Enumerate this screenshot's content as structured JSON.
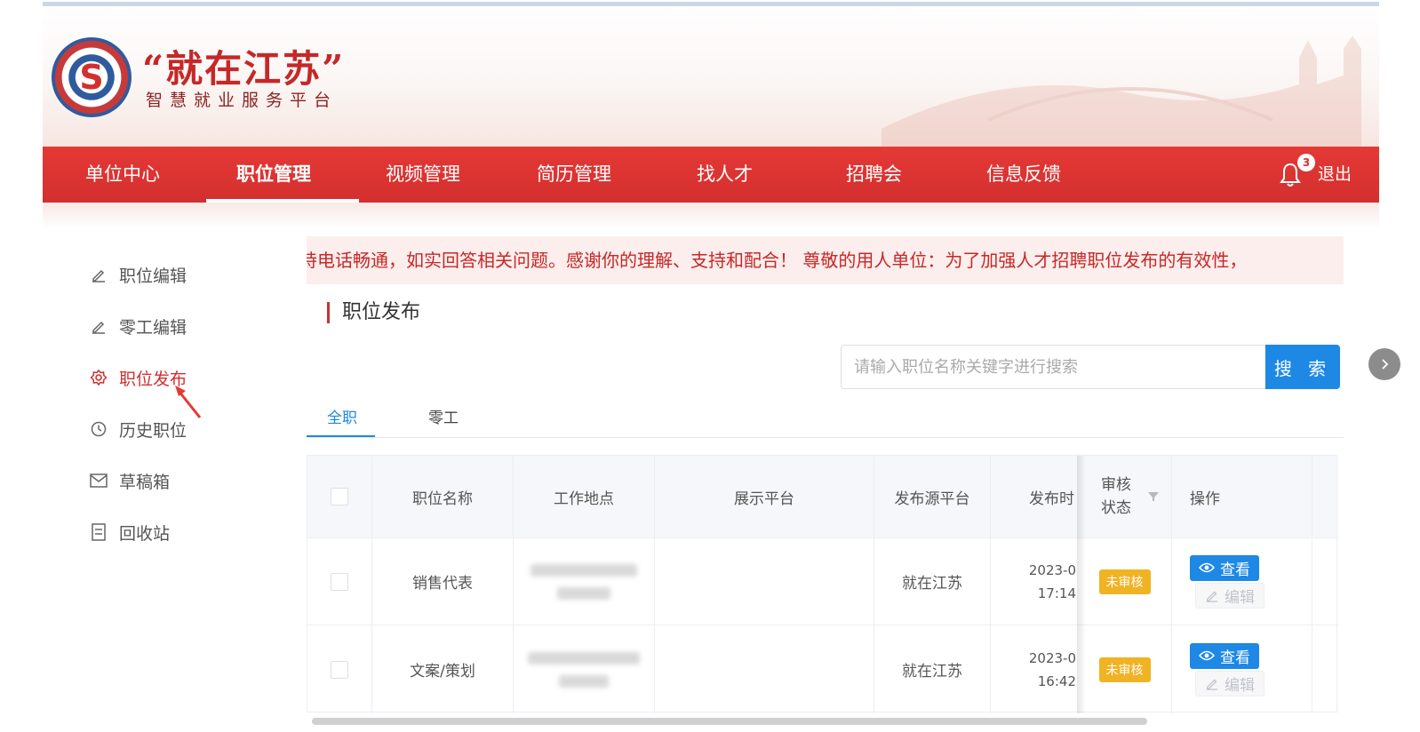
{
  "brand": {
    "title": "“就在江苏”",
    "subtitle": "智慧就业服务平台",
    "emblem_glyph": "S",
    "colors": {
      "primary": "#d32f2f",
      "accent": "#1e88e5",
      "warning": "#f0b323"
    }
  },
  "nav": {
    "items": [
      {
        "label": "单位中心"
      },
      {
        "label": "职位管理"
      },
      {
        "label": "视频管理"
      },
      {
        "label": "简历管理"
      },
      {
        "label": "找人才"
      },
      {
        "label": "招聘会"
      },
      {
        "label": "信息反馈"
      }
    ],
    "active": "职位管理",
    "notification_count": "3",
    "logout_label": "退出"
  },
  "sidebar": {
    "items": [
      {
        "label": "职位编辑",
        "icon": "pencil-icon"
      },
      {
        "label": "零工编辑",
        "icon": "pencil-icon"
      },
      {
        "label": "职位发布",
        "icon": "gear-icon"
      },
      {
        "label": "历史职位",
        "icon": "clock-icon"
      },
      {
        "label": "草稿箱",
        "icon": "mail-icon"
      },
      {
        "label": "回收站",
        "icon": "document-icon"
      }
    ],
    "active": "职位发布"
  },
  "notice": {
    "text": "持电话畅通，如实回答相关问题。感谢你的理解、支持和配合！ 尊敬的用人单位：为了加强人才招聘职位发布的有效性，"
  },
  "main": {
    "section_title": "职位发布",
    "search": {
      "placeholder": "请输入职位名称关键字进行搜索",
      "button_label": "搜 索"
    },
    "tabs": [
      {
        "label": "全职"
      },
      {
        "label": "零工"
      }
    ],
    "active_tab": "全职"
  },
  "table": {
    "columns": {
      "name": "职位名称",
      "location": "工作地点",
      "display_platform": "展示平台",
      "source_platform": "发布源平台",
      "publish_time": "发布时",
      "review_status_line1": "审核",
      "review_status_line2": "状态",
      "actions": "操作"
    },
    "rows": [
      {
        "name": "销售代表",
        "source_platform": "就在江苏",
        "time_line1": "2023-0",
        "time_line2": "17:14",
        "status": "未审核",
        "view_label": "查看",
        "edit_label": "编辑"
      },
      {
        "name": "文案/策划",
        "source_platform": "就在江苏",
        "time_line1": "2023-0",
        "time_line2": "16:42",
        "status": "未审核",
        "view_label": "查看",
        "edit_label": "编辑"
      }
    ]
  }
}
